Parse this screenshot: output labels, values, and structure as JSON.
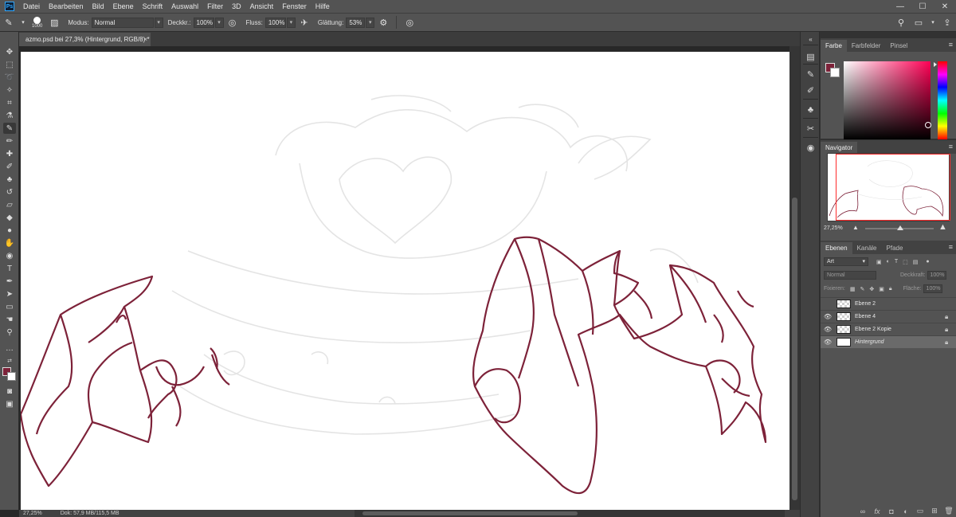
{
  "menubar": {
    "items": [
      "Datei",
      "Bearbeiten",
      "Bild",
      "Ebene",
      "Schrift",
      "Auswahl",
      "Filter",
      "3D",
      "Ansicht",
      "Fenster",
      "Hilfe"
    ],
    "logo": "Ps"
  },
  "window_controls": {
    "minimize": "—",
    "maximize": "☐",
    "close": "✕"
  },
  "options": {
    "brush_size": "1000",
    "mode_label": "Modus:",
    "mode_value": "Normal",
    "opacity_label": "Deckkr.:",
    "opacity_value": "100%",
    "flow_label": "Fluss:",
    "flow_value": "100%",
    "smoothing_label": "Glättung:",
    "smoothing_value": "53%"
  },
  "document": {
    "tab_title": "azmo.psd bei 27,3% (Hintergrund, RGB/8) *",
    "close": "×"
  },
  "status": {
    "zoom": "27,25%",
    "doc_size": "Dok: 57,9 MB/115,5 MB"
  },
  "colors": {
    "foreground": "#7d2239",
    "background": "#ffffff",
    "sketch_line": "#7d2239",
    "guide_line": "#e4e4e4"
  },
  "color_panel": {
    "tabs": [
      "Farbe",
      "Farbfelder",
      "Pinsel"
    ]
  },
  "navigator_panel": {
    "title": "Navigator",
    "zoom": "27,25%"
  },
  "layers_panel": {
    "tabs": [
      "Ebenen",
      "Kanäle",
      "Pfade"
    ],
    "filter_kind": "Art",
    "blend_mode": "Normal",
    "opacity_label": "Deckkraft:",
    "opacity_value": "100%",
    "lock_label": "Fixieren:",
    "fill_label": "Fläche:",
    "fill_value": "100%",
    "layers": [
      {
        "name": "Ebene 2",
        "visible": false,
        "locked": false
      },
      {
        "name": "Ebene 4",
        "visible": true,
        "locked": true
      },
      {
        "name": "Ebene 2 Kopie",
        "visible": true,
        "locked": true
      },
      {
        "name": "Hintergrund",
        "visible": true,
        "locked": true,
        "selected": true
      }
    ]
  }
}
